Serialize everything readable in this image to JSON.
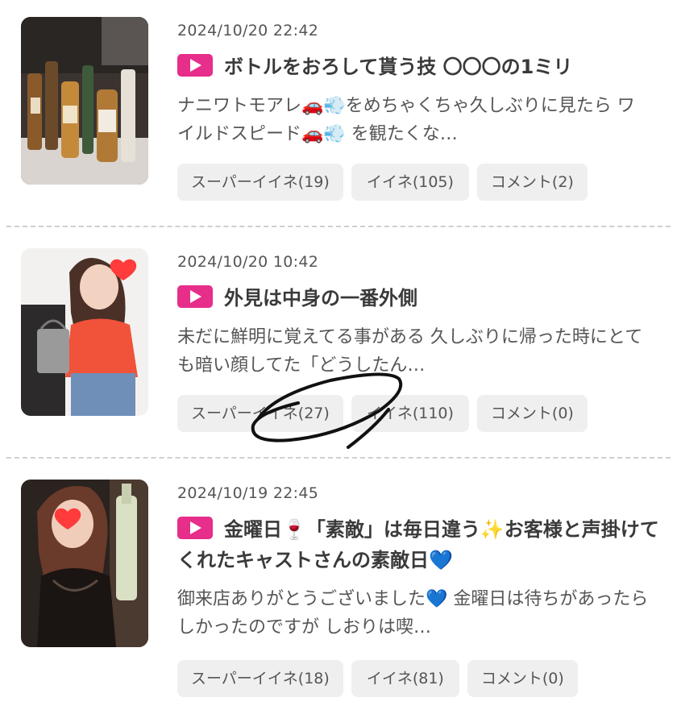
{
  "posts": [
    {
      "date": "2024/10/20 22:42",
      "title": "ボトルをおろして貰う技 〇〇〇の1ミリ",
      "excerpt": "ナニワトモアレ🚗💨をめちゃくちゃ久しぶりに見たら ワイルドスピード🚗💨 を観たくな…",
      "super_like": "スーパーイイネ(19)",
      "like": "イイネ(105)",
      "comment": "コメント(2)"
    },
    {
      "date": "2024/10/20 10:42",
      "title": "外見は中身の一番外側",
      "excerpt": "未だに鮮明に覚えてる事がある 久しぶりに帰った時にとても暗い顔してた「どうしたん…",
      "super_like": "スーパーイイネ(27)",
      "like": "イイネ(110)",
      "comment": "コメント(0)"
    },
    {
      "date": "2024/10/19 22:45",
      "title": "金曜日🍷「素敵」は毎日違う✨お客様と声掛けてくれたキャストさんの素敵日💙",
      "excerpt": "御来店ありがとうございました💙 金曜日は待ちがあったらしかったのですが しおりは喫…",
      "super_like": "スーパーイイネ(18)",
      "like": "イイネ(81)",
      "comment": "コメント(0)"
    }
  ],
  "colors": {
    "accent": "#e62e8a",
    "chip_bg": "#efefef",
    "text": "#3a3a3a",
    "muted": "#555555"
  },
  "icons": {
    "video": "play-icon"
  }
}
